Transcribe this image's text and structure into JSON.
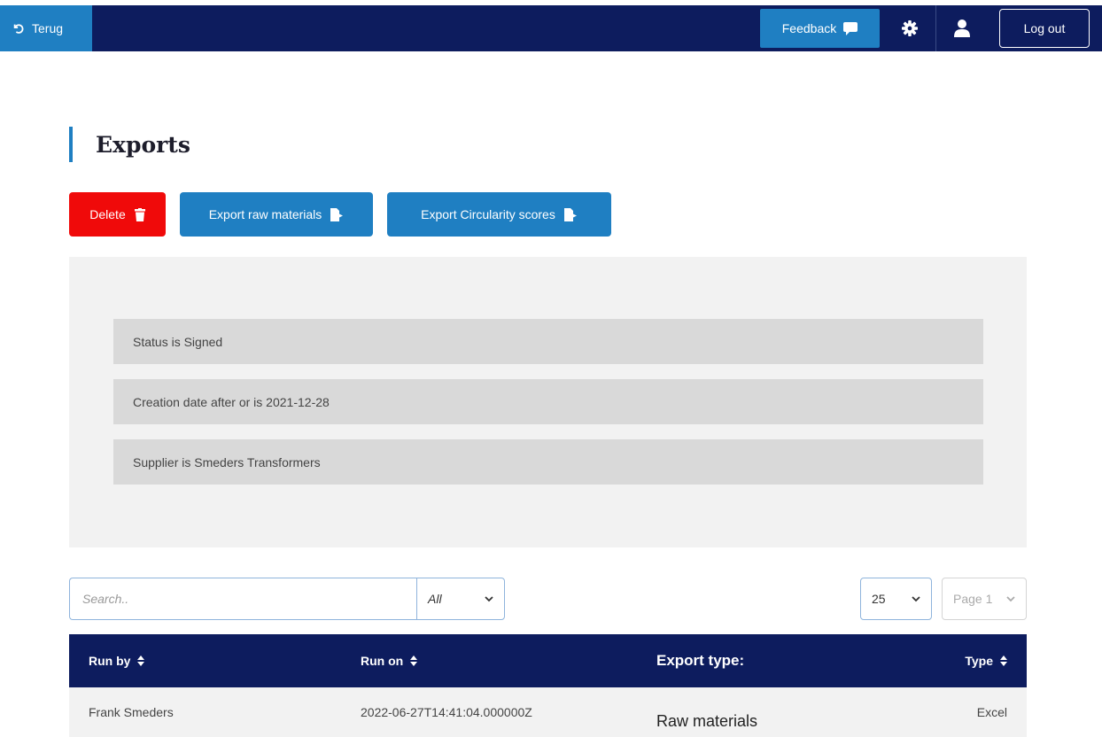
{
  "topbar": {
    "back_label": "Terug",
    "feedback_label": "Feedback",
    "logout_label": "Log out"
  },
  "page": {
    "title": "Exports"
  },
  "actions": {
    "delete_label": "Delete",
    "export_raw_label": "Export raw materials",
    "export_circularity_label": "Export Circularity scores"
  },
  "filters": [
    "Status is Signed",
    "Creation date after or is 2021-12-28",
    "Supplier is Smeders Transformers"
  ],
  "controls": {
    "search_placeholder": "Search..",
    "scope_value": "All",
    "page_size_value": "25",
    "page_value": "Page 1"
  },
  "table": {
    "headers": {
      "run_by": "Run by",
      "run_on": "Run on",
      "export_type": "Export type:",
      "type": "Type"
    },
    "rows": [
      {
        "run_by": "Frank Smeders",
        "run_on": "2022-06-27T14:41:04.000000Z",
        "export_type": "Raw materials",
        "type": "Excel"
      }
    ]
  },
  "colors": {
    "navy": "#0d1c5e",
    "accent_blue": "#1f7fc2",
    "danger_red": "#f00a0a"
  },
  "icons": {
    "back": "undo-icon",
    "feedback": "comment-icon",
    "settings": "gear-icon",
    "profile": "user-icon",
    "delete": "trash-icon",
    "export": "file-export-icon",
    "sort": "sort-icon",
    "dropdown": "chevron-down-icon"
  }
}
